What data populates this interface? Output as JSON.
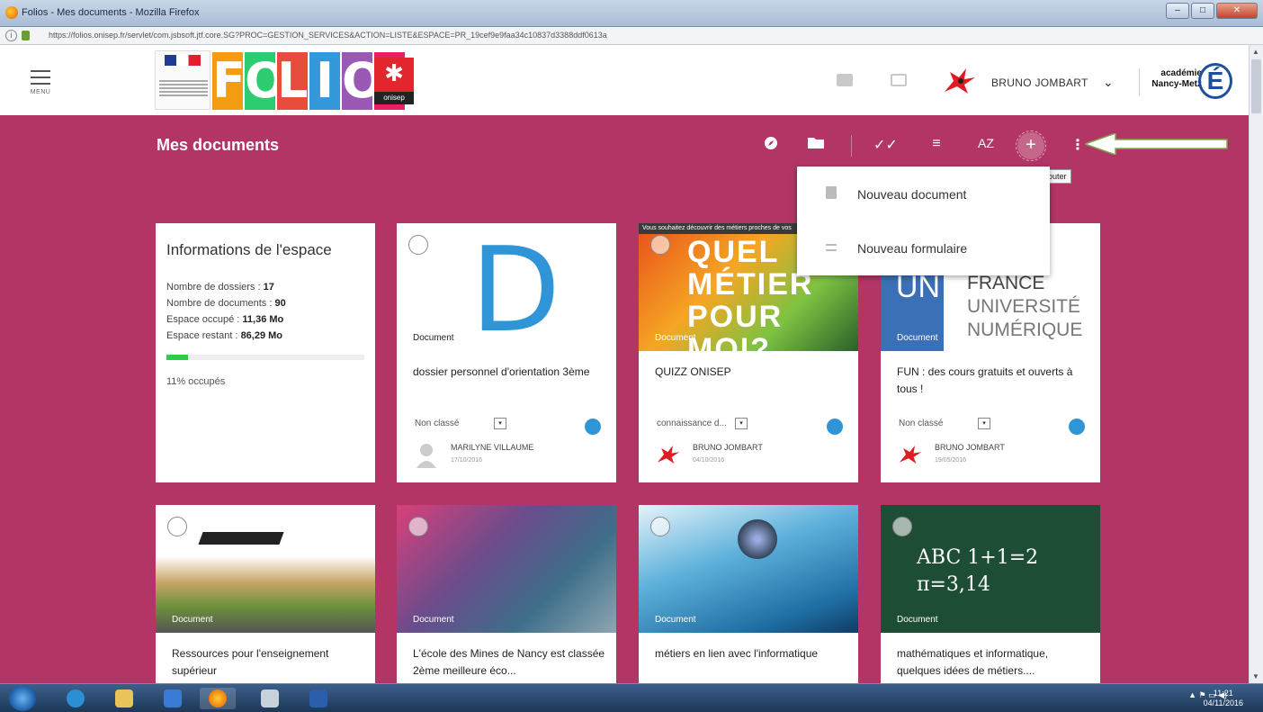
{
  "window": {
    "title": "Folios - Mes documents - Mozilla Firefox",
    "url": "https://folios.onisep.fr/servlet/com.jsbsoft.jtf.core.SG?PROC=GESTION_SERVICES&ACTION=LISTE&ESPACE=PR_19cef9e9faa34c10837d3388ddf0613a",
    "buttons": {
      "minimize": "–",
      "maximize": "□",
      "close": "✕"
    }
  },
  "header": {
    "menu_label": "MENU",
    "logo_letters": [
      "F",
      "O",
      "L",
      "I",
      "O",
      "S"
    ],
    "logo_colors": [
      "#f39c12",
      "#2ecc71",
      "#e74c3c",
      "#3498db",
      "#9b59b6",
      "#e91e63"
    ],
    "onisep_label": "onisep",
    "user_name": "BRUNO JOMBART",
    "academie_line1": "académie",
    "academie_line2": "Nancy-Metz",
    "academie_letter": "É"
  },
  "page": {
    "title": "Mes documents",
    "add_symbol": "+",
    "add_tooltip": "Ajouter",
    "more_symbol": "⋮",
    "sort_label": "AZ"
  },
  "dropdown": {
    "items": [
      {
        "label": "Nouveau document"
      },
      {
        "label": "Nouveau formulaire"
      }
    ]
  },
  "info": {
    "heading": "Informations de l'espace",
    "folders_label": "Nombre de dossiers :",
    "folders_value": "17",
    "documents_label": "Nombre de documents :",
    "documents_value": "90",
    "used_label": "Espace occupé :",
    "used_value": "11,36 Mo",
    "free_label": "Espace restant :",
    "free_value": "86,29 Mo",
    "used_fraction": 0.11,
    "used_text": "11% occupés"
  },
  "cards": [
    {
      "badge": "Document",
      "title": "dossier personnel d'orientation 3ème",
      "category": "Non classé",
      "author": "MARILYNE VILLAUME",
      "date": "17/10/2016",
      "letter": "D"
    },
    {
      "badge": "Document",
      "title": "QUIZZ ONISEP",
      "category": "connaissance d...",
      "author": "BRUNO JOMBART",
      "date": "04/10/2016",
      "banner": "Vous souhaitez découvrir des métiers proches de vos",
      "thumb_words": "QUEL MÉTIER POUR MOI?"
    },
    {
      "badge": "Document",
      "title": "FUN : des cours gratuits et ouverts à tous !",
      "category": "Non classé",
      "author": "BRUNO JOMBART",
      "date": "19/05/2016",
      "thumb_lines": [
        "FRANCE",
        "UNIVERSITÉ",
        "NUMÉRIQUE"
      ],
      "thumb_un": "UN"
    },
    {
      "badge": "Document",
      "title": "Ressources pour l'enseignement supérieur"
    },
    {
      "badge": "Document",
      "title": "L'école des Mines de Nancy est classée 2ème meilleure éco..."
    },
    {
      "badge": "Document",
      "title": "métiers en lien avec l'informatique"
    },
    {
      "badge": "Document",
      "title": "mathématiques et informatique, quelques idées de métiers....",
      "thumb_text": "ABC  1+1=2  π=3,14"
    }
  ],
  "taskbar": {
    "time": "11:21",
    "date": "04/11/2016"
  }
}
